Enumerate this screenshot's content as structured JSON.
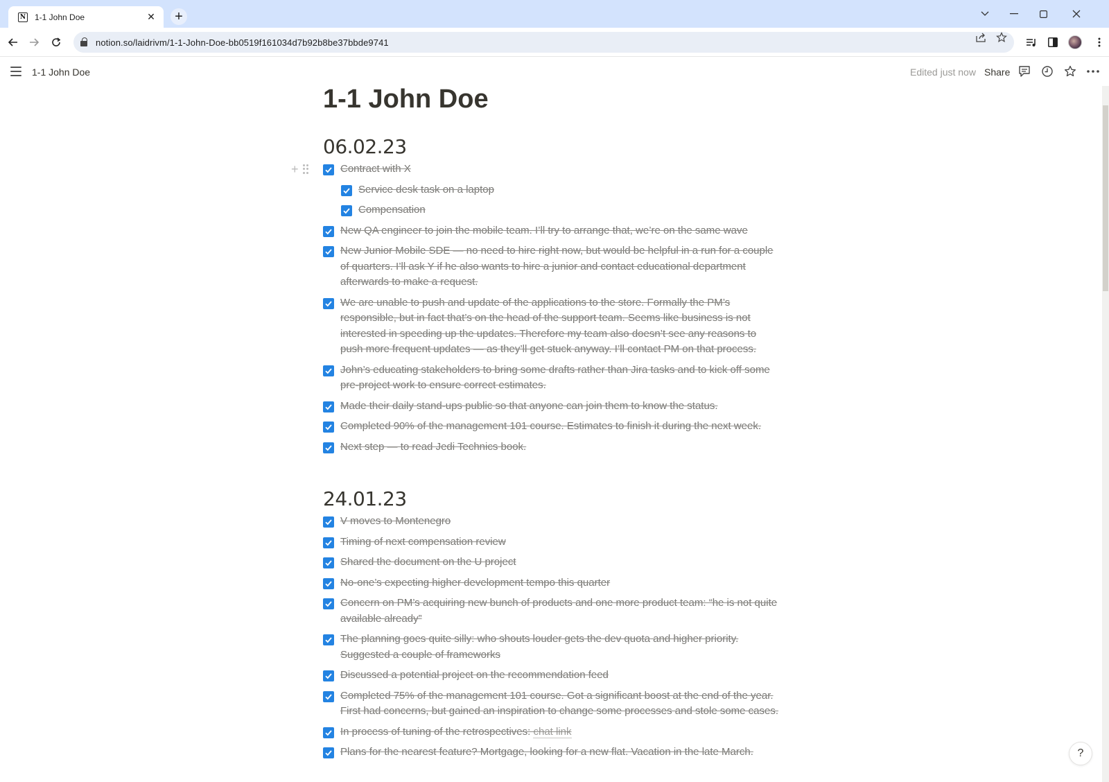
{
  "browser": {
    "tab_title": "1-1 John Doe",
    "url": "notion.so/laidrivm/1-1-John-Doe-bb0519f161034d7b92b8be37bbde9741"
  },
  "topbar": {
    "breadcrumb": "1-1 John Doe",
    "edited": "Edited just now",
    "share": "Share"
  },
  "page": {
    "title": "1-1 John Doe",
    "sections": [
      {
        "heading": "06.02.23",
        "todos": [
          {
            "text": "Contract with X",
            "checked": true
          },
          {
            "text": "Service desk task on a laptop",
            "checked": true,
            "nested": true
          },
          {
            "text": "Compensation",
            "checked": true,
            "nested": true
          },
          {
            "text": "New QA engineer to join the mobile team. I’ll try to arrange that, we’re on the same wave",
            "checked": true
          },
          {
            "text": "New Junior Mobile SDE — no need to hire right now, but would be helpful in a run for a couple of quarters. I’ll ask Y if he also wants to hire a junior and contact educational department afterwards to make a request.",
            "checked": true
          },
          {
            "text": "We are unable to push and update of the applications to the store. Formally the PM’s responsible, but in fact that’s on the head of the support team. Seems like business is not interested in speeding up the updates. Therefore my team also doesn’t see any reasons to push more frequent updates — as they’ll get stuck anyway. I’ll contact PM on that process.",
            "checked": true
          },
          {
            "text": "John’s educating stakeholders to bring some drafts rather than Jira tasks and to kick off some pre-project work to ensure correct estimates.",
            "checked": true
          },
          {
            "text": "Made their daily stand-ups public so that anyone can join them to know the status.",
            "checked": true
          },
          {
            "text": "Completed 90% of the management 101 course. Estimates to finish it during the next week.",
            "checked": true
          },
          {
            "text": "Next step — to read Jedi Technics book.",
            "checked": true
          }
        ]
      },
      {
        "heading": "24.01.23",
        "todos": [
          {
            "text": "V moves to Montenegro",
            "checked": true
          },
          {
            "text": "Timing of next compensation review",
            "checked": true
          },
          {
            "text": "Shared the document on the U project",
            "checked": true
          },
          {
            "text": "No-one’s expecting higher development tempo this quarter",
            "checked": true
          },
          {
            "text": "Concern on PM’s acquiring new bunch of products and one more product team: “he is not quite available already”",
            "checked": true
          },
          {
            "text": "The planning goes quite silly: who shouts louder gets the dev quota and higher priority. Suggested a couple of frameworks",
            "checked": true
          },
          {
            "text": "Discussed a potential project on the recommendation feed",
            "checked": true
          },
          {
            "text": "Completed 75% of the management 101 course. Got a significant boost at the end of the year. First had concerns, but gained an inspiration to change some processes and stole some cases.",
            "checked": true
          },
          {
            "text": "In process of tuning of the retrospectives: ",
            "link": "chat link",
            "checked": true
          },
          {
            "text": "Plans for the nearest feature? Mortgage, looking for a new flat. Vacation in the late March.",
            "checked": true
          }
        ]
      }
    ]
  },
  "help_label": "?",
  "colors": {
    "checkbox": "#2383e2",
    "text": "#37352f",
    "muted": "#787774",
    "tabstrip": "#d3e3fd"
  }
}
